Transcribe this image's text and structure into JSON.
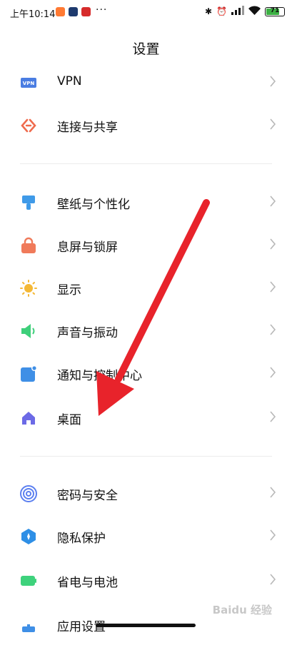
{
  "status_bar": {
    "time": "上午10:14",
    "more": "···",
    "battery": "71"
  },
  "page": {
    "title": "设置"
  },
  "groups": [
    {
      "items": [
        {
          "label": "VPN",
          "icon": "vpn-icon"
        },
        {
          "label": "连接与共享",
          "icon": "connection-share-icon"
        }
      ]
    },
    {
      "items": [
        {
          "label": "壁纸与个性化",
          "icon": "wallpaper-icon"
        },
        {
          "label": "息屏与锁屏",
          "icon": "lock-icon"
        },
        {
          "label": "显示",
          "icon": "sun-icon"
        },
        {
          "label": "声音与振动",
          "icon": "speaker-icon"
        },
        {
          "label": "通知与控制中心",
          "icon": "notification-icon"
        },
        {
          "label": "桌面",
          "icon": "home-icon"
        }
      ]
    },
    {
      "items": [
        {
          "label": "密码与安全",
          "icon": "fingerprint-icon"
        },
        {
          "label": "隐私保护",
          "icon": "privacy-icon"
        },
        {
          "label": "省电与电池",
          "icon": "battery-icon"
        },
        {
          "label": "应用设置",
          "icon": "apps-icon"
        }
      ]
    }
  ],
  "colors": {
    "vpn": "#4a7de2",
    "connect": "#ef6b4d",
    "wallpaper": "#3f9ae8",
    "lock": "#f07a5a",
    "display": "#f4b836",
    "sound": "#3ecf7a",
    "notify": "#3f8fe6",
    "home": "#6c6ae6",
    "security": "#5b7ff0",
    "privacy": "#2e8fe6",
    "battery": "#3ed27c",
    "arrow": "#e8232b"
  },
  "watermark": "Baidu 经验"
}
